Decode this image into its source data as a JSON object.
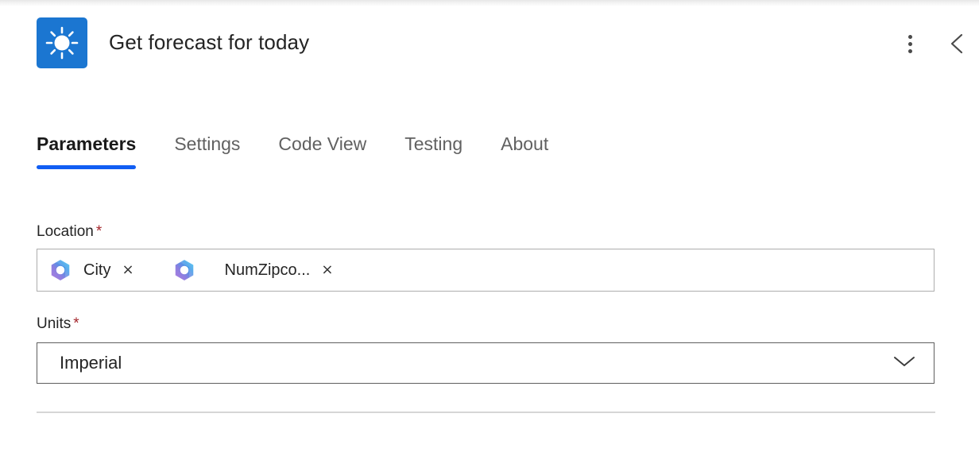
{
  "header": {
    "title": "Get forecast for today",
    "app_icon": "sun-icon",
    "icon_bg_color": "#1b76d1",
    "more_options_label": "More options",
    "more_options_icon": "kebab-menu-icon",
    "collapse_label": "Collapse",
    "collapse_icon": "chevron-left-icon"
  },
  "tabs": {
    "active": "Parameters",
    "accent_color": "#115ef3",
    "items": [
      {
        "label": "Parameters",
        "active": true
      },
      {
        "label": "Settings",
        "active": false
      },
      {
        "label": "Code View",
        "active": false
      },
      {
        "label": "Testing",
        "active": false
      },
      {
        "label": "About",
        "active": false
      }
    ]
  },
  "form": {
    "required_marker": "*",
    "required_color": "#a4262c",
    "location": {
      "label": "Location",
      "required": true,
      "chips": [
        {
          "label": "City",
          "icon": "copilot-hex-icon",
          "remove_icon": "close-icon",
          "remove_label": "×"
        },
        {
          "label": "NumZipco...",
          "icon": "copilot-hex-icon",
          "remove_icon": "close-icon",
          "remove_label": "×"
        }
      ]
    },
    "units": {
      "label": "Units",
      "required": true,
      "value": "Imperial",
      "chevron_icon": "chevron-down-icon",
      "options": [
        "Imperial"
      ]
    }
  }
}
